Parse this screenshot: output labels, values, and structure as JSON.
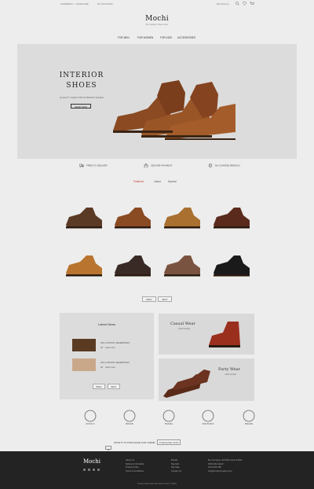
{
  "topbar": {
    "left_1": "CURRENCY",
    "left_2": "LANGUAGE",
    "left_3": "MY ACCOUNT",
    "right_1": "My Account",
    "right_2": "WISHLIST",
    "right_3": "CART"
  },
  "logo": {
    "title": "Mochi",
    "subtitle": "Men Fashion Shoes Store"
  },
  "nav": {
    "items": [
      "FOR MEN",
      "FOR WOMEN",
      "FOR KIDS",
      "ACCESSORIES"
    ]
  },
  "hero": {
    "title_line1": "INTERIOR",
    "title_line2": "SHOES",
    "subtitle": "QUALITY SHOP FOR INTERIOR SHOES",
    "button": "SHOP NOW"
  },
  "features": [
    "FREE TO DELIVER",
    "SECURE PAYMENT",
    "NO CHARGE BRANCH"
  ],
  "tabs": {
    "items": [
      "Featured",
      "Latest",
      "Special"
    ],
    "active": 0
  },
  "products": [
    {
      "name": "shoe-1",
      "color": "#5b3a25"
    },
    {
      "name": "shoe-2",
      "color": "#8a4a22"
    },
    {
      "name": "shoe-3",
      "color": "#a9702f"
    },
    {
      "name": "shoe-4",
      "color": "#5a2b1c"
    },
    {
      "name": "shoe-5",
      "color": "#b9742f"
    },
    {
      "name": "shoe-6",
      "color": "#3a2a25"
    },
    {
      "name": "shoe-7",
      "color": "#7a5340"
    },
    {
      "name": "shoe-8",
      "color": "#1a1a1a"
    }
  ],
  "pager": {
    "prev": "PREV",
    "next": "NEXT"
  },
  "blog": {
    "title": "Latest News",
    "items": [
      {
        "meta": "HOLLYWOOD CELEBRITIES",
        "date": "18",
        "more": "read more"
      },
      {
        "meta": "HOLLYWOOD CELEBRITIES",
        "date": "18",
        "more": "read more"
      }
    ],
    "prev": "PREV",
    "next": "NEXT"
  },
  "banners": [
    {
      "title": "Casual Wear",
      "sub": "VIEW MORE"
    },
    {
      "title": "Party Wear",
      "sub": "VIEW MORE"
    }
  ],
  "brands": [
    "ROCK N",
    "BRAND",
    "TRAVEL",
    "MOUNTAIN",
    "BRAND"
  ],
  "newsletter": {
    "text": "WANT'S TO PURCHASE OUR THEME",
    "button": "PURCHASE NOW"
  },
  "footer": {
    "logo": "Mochi",
    "col1": [
      "About Us",
      "Delivery Information",
      "Privacy Policy",
      "Terms & Conditions"
    ],
    "col2": [
      "Brands",
      "Specials",
      "Site Map",
      "Contact Us"
    ],
    "col3": [
      "My Company, 42 Puffin street 12910",
      "Puffinville Island",
      "0123-456-789",
      "info@mochicompany.com"
    ],
    "copyright": "Powered By OpenCart Demo Store © 2024"
  },
  "colors": {
    "accent": "#c0392b",
    "footer_bg": "#232323",
    "hero_bg": "#dcdcdc"
  }
}
